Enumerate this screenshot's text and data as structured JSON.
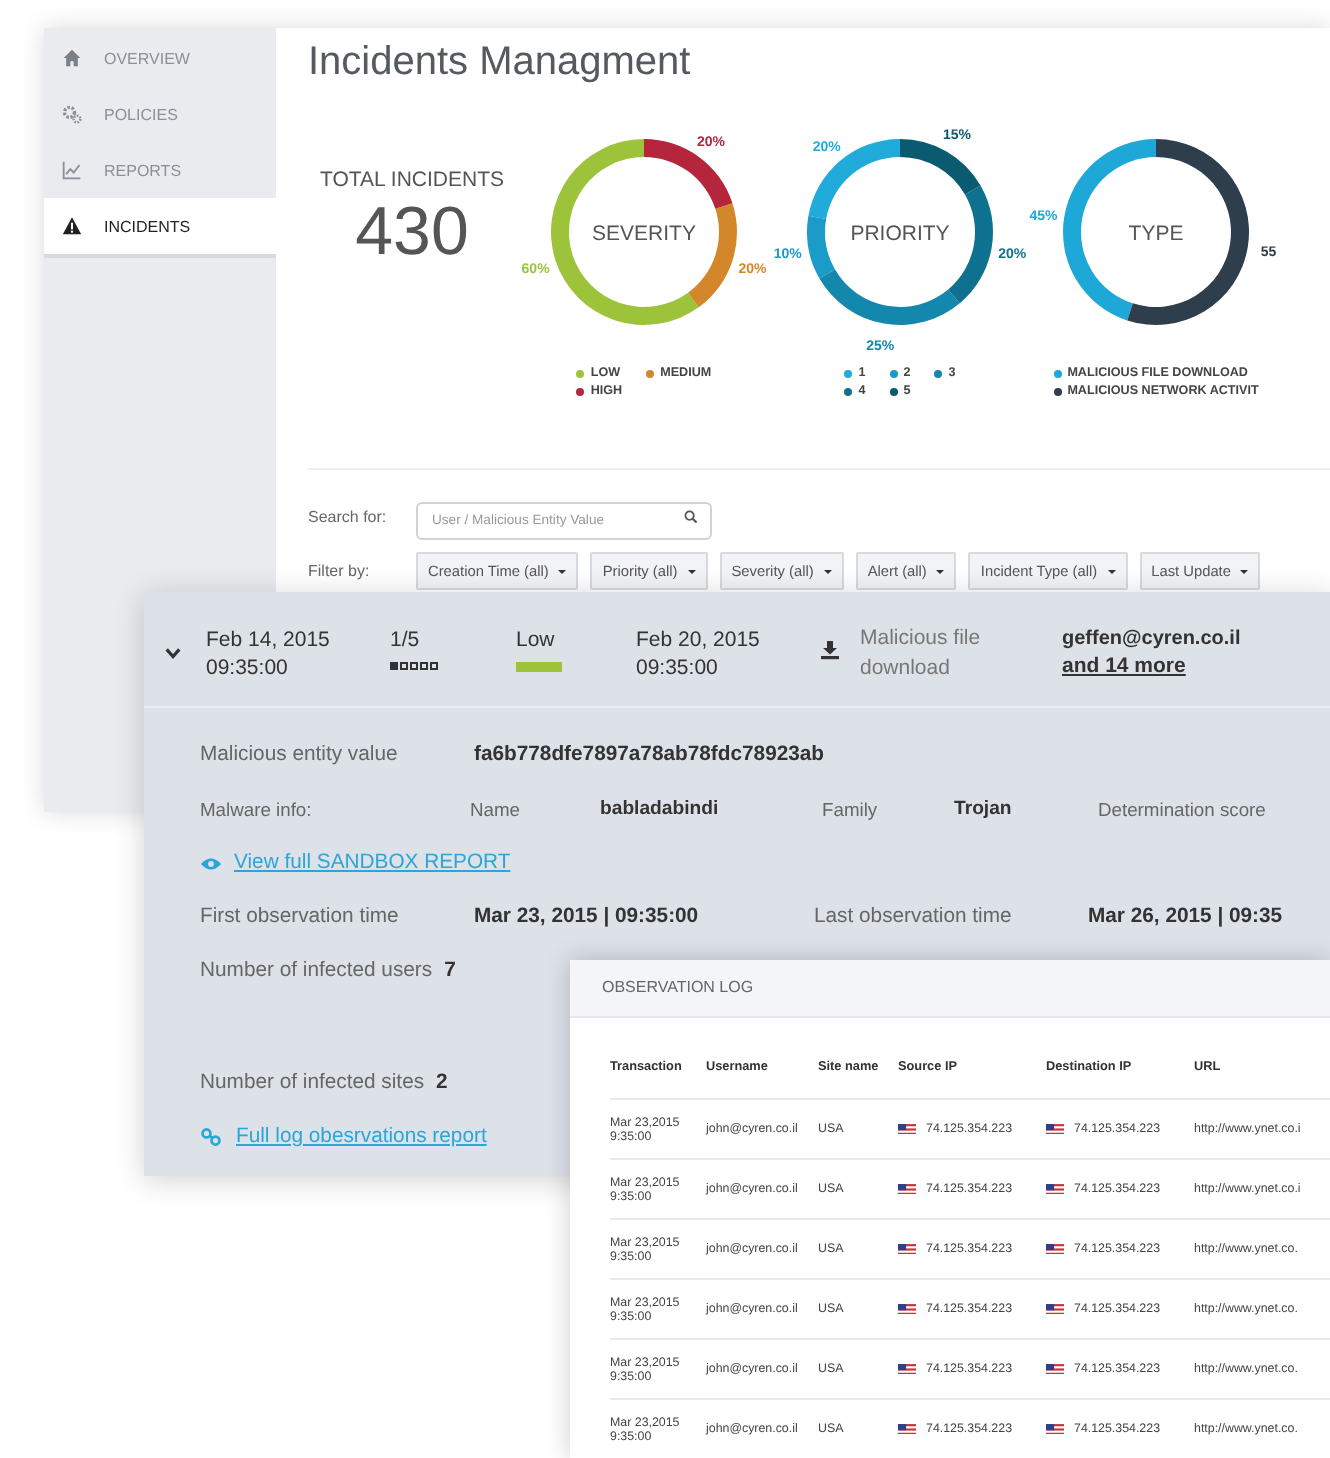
{
  "sidebar": {
    "items": [
      {
        "kind": "home",
        "label": "OVERVIEW",
        "selected": false
      },
      {
        "kind": "gears",
        "label": "POLICIES",
        "selected": false
      },
      {
        "kind": "chart",
        "label": "REPORTS",
        "selected": false
      },
      {
        "kind": "warning",
        "label": "INCIDENTS",
        "selected": true
      }
    ]
  },
  "page_title": "Incidents Managment",
  "summary": {
    "label": "TOTAL INCIDENTS",
    "value": "430"
  },
  "charts": [
    {
      "chart_data": {
        "type": "donut",
        "title": "SEVERITY",
        "categories": [
          "LOW",
          "MEDIUM",
          "HIGH"
        ],
        "values": [
          60,
          20,
          20
        ],
        "colors": [
          "#9dc33b",
          "#d4862b",
          "#b5253c"
        ],
        "value_labels": [
          "60%",
          "20%",
          "20%"
        ]
      }
    },
    {
      "chart_data": {
        "type": "donut",
        "title": "PRIORITY",
        "categories": [
          "1",
          "2",
          "3",
          "4",
          "5"
        ],
        "values": [
          20,
          10,
          25,
          20,
          15
        ],
        "colors": [
          "#21abdb",
          "#1a9bc8",
          "#1487ad",
          "#0f7190",
          "#0a5a70"
        ],
        "value_labels": [
          "20%",
          "10%",
          "25%",
          "20%",
          "15%"
        ]
      }
    },
    {
      "chart_data": {
        "type": "donut",
        "title": "TYPE",
        "categories": [
          "MALICIOUS FILE DOWNLOAD",
          "MALICIOUS NETWORK ACTIVIT"
        ],
        "values": [
          45,
          55
        ],
        "colors": [
          "#1ea8d8",
          "#2e3e4c"
        ],
        "value_labels": [
          "45%",
          "55"
        ]
      }
    }
  ],
  "search": {
    "label": "Search for:",
    "placeholder": "User / Malicious Entity Value"
  },
  "filters": {
    "label": "Filter by:",
    "buttons": [
      "Creation Time (all)",
      "Priority (all)",
      "Severity (all)",
      "Alert (all)",
      "Incident Type (all)",
      "Last Update"
    ]
  },
  "incident": {
    "expanded": true,
    "created_date": "Feb 14, 2015",
    "created_time": "09:35:00",
    "priority": {
      "text": "1/5",
      "stars": 1
    },
    "severity": {
      "label": "Low",
      "color": "#9dc33b"
    },
    "updated_date": "Feb 20, 2015",
    "updated_time": "09:35:00",
    "type": "Malicious file download",
    "user": "geffen@cyren.co.il",
    "more_link": "and 14 more",
    "entity_label": "Malicious entity value",
    "entity_value": "fa6b778dfe7897a78ab78fdc78923ab",
    "malware_label": "Malware info:",
    "name_label": "Name",
    "name_value": "babladabindi",
    "family_label": "Family",
    "family_value": "Trojan",
    "score_label": "Determination score",
    "sandbox_link": "View full SANDBOX REPORT",
    "first_label": "First observation time",
    "first_value": "Mar 23, 2015  |  09:35:00",
    "last_label": "Last observation time",
    "last_value": "Mar 26, 2015  |  09:35",
    "users_label": "Number of infected users",
    "users_value": "7",
    "sites_label": "Number of infected sites",
    "sites_value": "2",
    "log_link": "Full log obesrvations report"
  },
  "observation_log": {
    "title": "OBSERVATION LOG",
    "columns": [
      "Transaction",
      "Username",
      "Site name",
      "Source IP",
      "Destination IP",
      "URL"
    ],
    "rows": [
      {
        "date": "Mar 23,2015",
        "time": "9:35:00",
        "username": "john@cyren.co.il",
        "site": "USA",
        "source_ip": "74.125.354.223",
        "destination_ip": "74.125.354.223",
        "url": "http://www.ynet.co.i"
      },
      {
        "date": "Mar 23,2015",
        "time": "9:35:00",
        "username": "john@cyren.co.il",
        "site": "USA",
        "source_ip": "74.125.354.223",
        "destination_ip": "74.125.354.223",
        "url": "http://www.ynet.co.i"
      },
      {
        "date": "Mar 23,2015",
        "time": "9:35:00",
        "username": "john@cyren.co.il",
        "site": "USA",
        "source_ip": "74.125.354.223",
        "destination_ip": "74.125.354.223",
        "url": "http://www.ynet.co."
      },
      {
        "date": "Mar 23,2015",
        "time": "9:35:00",
        "username": "john@cyren.co.il",
        "site": "USA",
        "source_ip": "74.125.354.223",
        "destination_ip": "74.125.354.223",
        "url": "http://www.ynet.co."
      },
      {
        "date": "Mar 23,2015",
        "time": "9:35:00",
        "username": "john@cyren.co.il",
        "site": "USA",
        "source_ip": "74.125.354.223",
        "destination_ip": "74.125.354.223",
        "url": "http://www.ynet.co."
      },
      {
        "date": "Mar 23,2015",
        "time": "9:35:00",
        "username": "john@cyren.co.il",
        "site": "USA",
        "source_ip": "74.125.354.223",
        "destination_ip": "74.125.354.223",
        "url": "http://www.ynet.co."
      }
    ]
  }
}
